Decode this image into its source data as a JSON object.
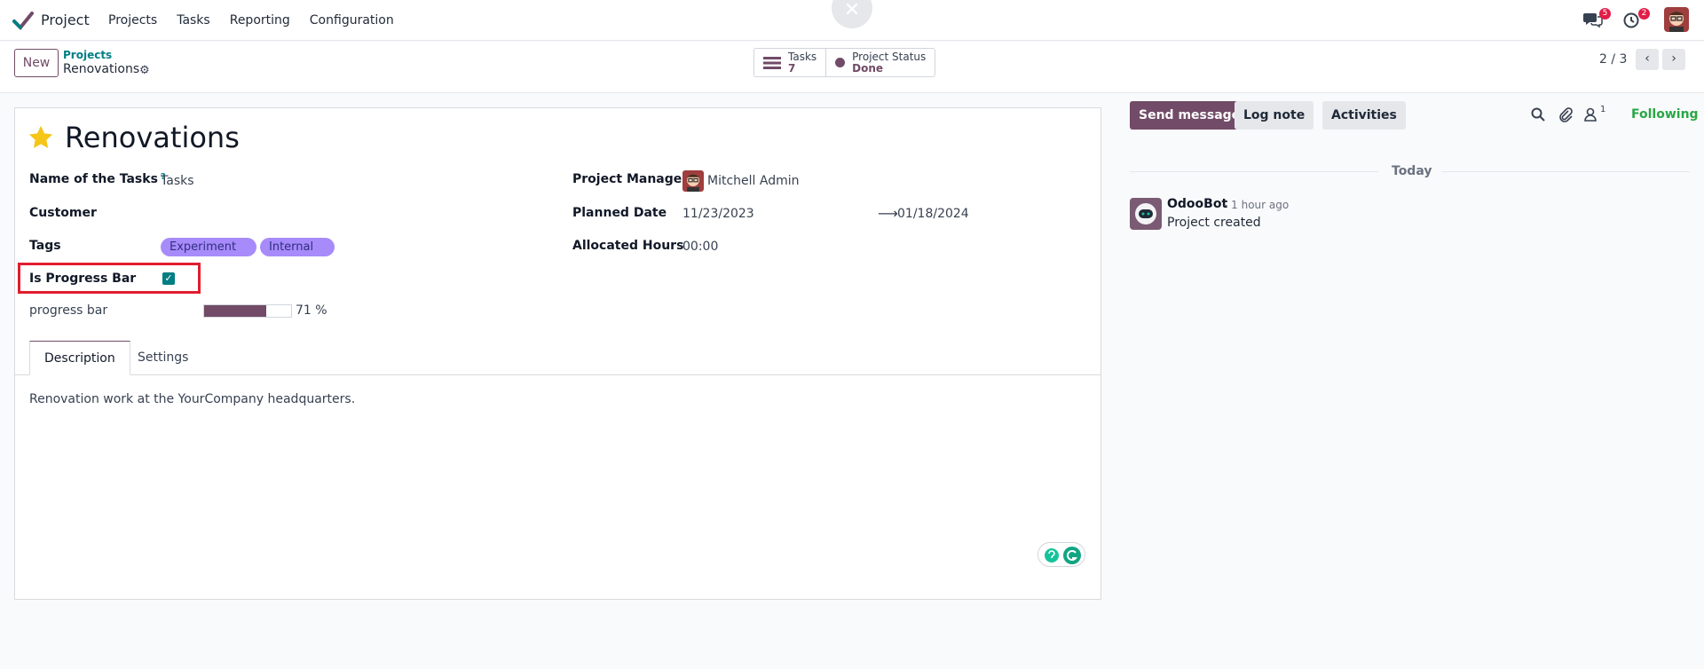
{
  "navbar": {
    "app_name": "Project",
    "menu": [
      "Projects",
      "Tasks",
      "Reporting",
      "Configuration"
    ],
    "messages_badge": "5",
    "activities_badge": "2"
  },
  "control_panel": {
    "new_label": "New",
    "breadcrumb_parent": "Projects",
    "breadcrumb_current": "Renovations",
    "smart_buttons": {
      "tasks_label": "Tasks",
      "tasks_count": "7",
      "status_label": "Project Status",
      "status_value": "Done"
    },
    "pager": "2 / 3"
  },
  "form": {
    "title": "Renovations",
    "fields": {
      "name_of_tasks_label": "Name of the Tasks",
      "name_of_tasks_help": "?",
      "name_of_tasks_value": "Tasks",
      "customer_label": "Customer",
      "tags_label": "Tags",
      "tags": [
        "Experiment",
        "Internal"
      ],
      "is_progress_bar_label": "Is Progress Bar",
      "is_progress_bar_checked": true,
      "progress_bar_label": "progress bar",
      "progress_value": 71,
      "progress_text": "71 %",
      "project_manager_label": "Project Manager",
      "project_manager_value": "Mitchell Admin",
      "planned_date_label": "Planned Date",
      "planned_date_start": "11/23/2023",
      "planned_date_end": "01/18/2024",
      "allocated_hours_label": "Allocated Hours",
      "allocated_hours_value": "00:00"
    },
    "tabs": [
      "Description",
      "Settings"
    ],
    "description": "Renovation work at the YourCompany headquarters."
  },
  "chatter": {
    "send_message": "Send message",
    "log_note": "Log note",
    "activities": "Activities",
    "followers_count": "1",
    "following": "Following",
    "date_separator": "Today",
    "messages": [
      {
        "author": "OdooBot",
        "time": "- 1 hour ago",
        "body": "Project created"
      }
    ]
  },
  "colors": {
    "brand": "#714b67",
    "teal": "#017e84",
    "tag": "#a78bfa",
    "following": "#28a745",
    "highlight": "#e11d2e"
  }
}
